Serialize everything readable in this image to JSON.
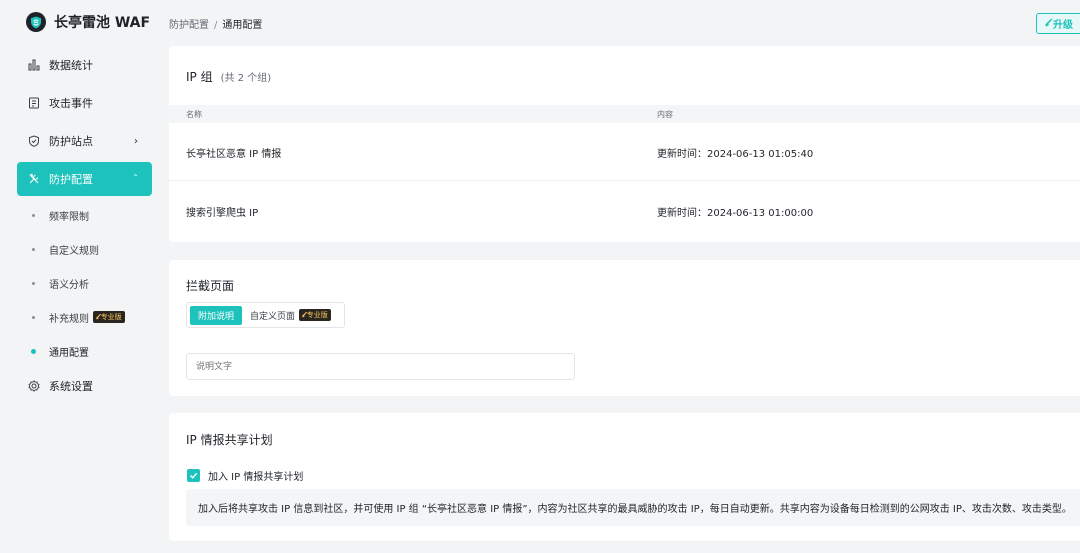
{
  "app": {
    "name": "长亭雷池 WAF"
  },
  "breadcrumb": {
    "parent": "防护配置",
    "separator": "/",
    "current": "通用配置"
  },
  "upgrade": {
    "label": "升级"
  },
  "sidebar": {
    "items": [
      {
        "label": "数据统计",
        "icon": "bar-chart-icon"
      },
      {
        "label": "攻击事件",
        "icon": "document-icon"
      },
      {
        "label": "防护站点",
        "icon": "shield-icon"
      },
      {
        "label": "防护配置",
        "icon": "tools-icon"
      },
      {
        "label": "系统设置",
        "icon": "gear-icon"
      }
    ],
    "subitems": [
      {
        "label": "频率限制"
      },
      {
        "label": "自定义规则"
      },
      {
        "label": "语义分析"
      },
      {
        "label": "补充规则",
        "badge": "专业版"
      },
      {
        "label": "通用配置"
      }
    ]
  },
  "ip_group": {
    "title": "IP 组",
    "count": "(共 2 个组)",
    "columns": [
      "名称",
      "内容"
    ],
    "rows": [
      {
        "name": "长亭社区恶意 IP 情报",
        "content": "更新时间：2024-06-13 01:05:40"
      },
      {
        "name": "搜索引擎爬虫 IP",
        "content": "更新时间：2024-06-13 01:00:00"
      }
    ]
  },
  "block_page": {
    "title": "拦截页面",
    "tabs": [
      "附加说明",
      "自定义页面"
    ],
    "badge": "专业版",
    "input_placeholder": "说明文字"
  },
  "ip_share": {
    "title": "IP 情报共享计划",
    "checkbox_label": "加入 IP 情报共享计划",
    "description": "加入后将共享攻击 IP 信息到社区，并可使用 IP 组 “长亭社区恶意 IP 情报”，内容为社区共享的最具威胁的攻击 IP，每日自动更新。共享内容为设备每日检测到的公网攻击 IP、攻击次数、攻击类型。"
  },
  "colors": {
    "accent": "#1ec2bc",
    "background": "#f2f4f5",
    "pro_badge": "#2b2520"
  }
}
